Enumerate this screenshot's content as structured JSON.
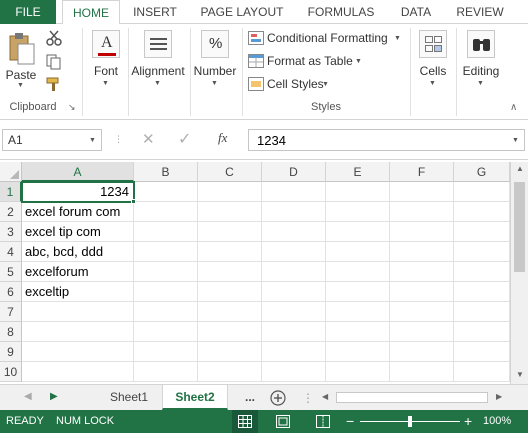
{
  "ribbon_tabs": {
    "file": "FILE",
    "items": [
      "HOME",
      "INSERT",
      "PAGE LAYOUT",
      "FORMULAS",
      "DATA",
      "REVIEW"
    ]
  },
  "ribbon": {
    "clipboard": {
      "paste_label": "Paste",
      "group_label": "Clipboard"
    },
    "font": {
      "label": "Font"
    },
    "alignment": {
      "label": "Alignment"
    },
    "number": {
      "label": "Number"
    },
    "styles": {
      "conditional_formatting": "Conditional Formatting",
      "format_as_table": "Format as Table",
      "cell_styles": "Cell Styles",
      "group_label": "Styles"
    },
    "cells": {
      "label": "Cells"
    },
    "editing": {
      "label": "Editing"
    }
  },
  "formula_bar": {
    "name_box": "A1",
    "fx": "fx",
    "value": "1234"
  },
  "grid": {
    "columns": [
      "A",
      "B",
      "C",
      "D",
      "E",
      "F",
      "G"
    ],
    "rows": [
      "1",
      "2",
      "3",
      "4",
      "5",
      "6",
      "7",
      "8",
      "9",
      "10"
    ],
    "cells_a": [
      "1234",
      "excel forum com",
      "excel tip com",
      "abc, bcd, ddd",
      "excelforum",
      "exceltip",
      "",
      "",
      "",
      ""
    ]
  },
  "sheets": {
    "tabs": [
      "Sheet1",
      "Sheet2"
    ],
    "active": "Sheet2",
    "more": "..."
  },
  "status": {
    "ready": "READY",
    "numlock": "NUM LOCK",
    "zoom": "100%",
    "zoom_level": 1.0
  },
  "colors": {
    "brand": "#217346",
    "selection": "#217346"
  }
}
